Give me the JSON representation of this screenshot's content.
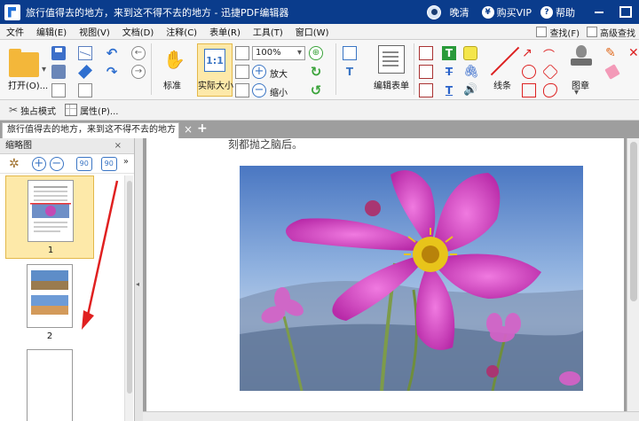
{
  "window": {
    "title": "旅行值得去的地方，来到这不得不去的地方 - 迅捷PDF编辑器",
    "user_name": "晚清",
    "vip_label": "购买VIP",
    "vip_glyph": "¥",
    "help_label": "帮助",
    "help_glyph": "?"
  },
  "menu": {
    "items": [
      "文件",
      "编辑(E)",
      "视图(V)",
      "文档(D)",
      "注释(C)",
      "表单(R)",
      "工具(T)",
      "窗口(W)"
    ],
    "find_label": "查找(F)",
    "adv_find_label": "高级查找"
  },
  "ribbon": {
    "open_label": "打开(O)...",
    "standard_label": "标准",
    "actual_size_label": "实际大小",
    "actual_size_glyph": "1:1",
    "zoom_value": "100%",
    "zoom_in_label": "放大",
    "zoom_out_label": "缩小",
    "edit_form_label": "编辑表单",
    "line_label": "线条",
    "stamp_label": "图章"
  },
  "subbar": {
    "exclusive_mode_label": "独占模式",
    "properties_label": "属性(P)..."
  },
  "document_tab": {
    "label": "旅行值得去的地方，来到这不得不去的地方 *",
    "close_glyph": "×",
    "add_glyph": "+"
  },
  "thumbnails": {
    "header": "缩略图",
    "close_glyph": "×",
    "pages": [
      {
        "number": "1",
        "selected": true
      },
      {
        "number": "2",
        "selected": false
      },
      {
        "number": "",
        "selected": false
      }
    ]
  },
  "page_content": {
    "top_text": "刻都抛之脑后。"
  },
  "colors": {
    "titlebar": "#0a3c8c",
    "highlight": "#fde9a9",
    "annotation_arrow": "#e02020"
  }
}
